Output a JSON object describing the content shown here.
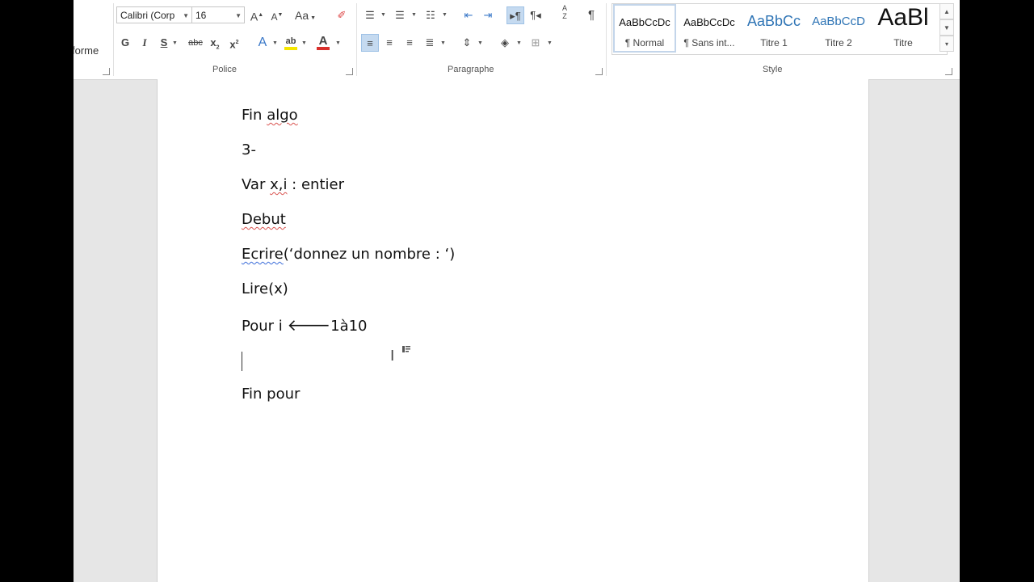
{
  "ribbon": {
    "clipped_label": "forme",
    "font": {
      "name": "Calibri (Corp",
      "size": "16"
    },
    "buttons": {
      "grow": "A",
      "shrink": "A",
      "case": "Aa",
      "bold": "G",
      "italic": "I",
      "underline": "S",
      "strike": "abc",
      "subscript": "x",
      "superscript": "x",
      "sub_mark": "2",
      "sup_mark": "2",
      "effects": "A",
      "highlight": "ab",
      "font_color": "A",
      "pilcrow": "¶",
      "sort_top": "A",
      "sort_bottom": "Z"
    },
    "groups": {
      "police": "Police",
      "paragraphe": "Paragraphe",
      "style": "Style"
    },
    "styles": [
      {
        "preview": "AaBbCcDc",
        "name": "¶ Normal"
      },
      {
        "preview": "AaBbCcDc",
        "name": "¶ Sans int..."
      },
      {
        "preview": "AaBbCc",
        "name": "Titre 1"
      },
      {
        "preview": "AaBbCcD",
        "name": "Titre 2"
      },
      {
        "preview": "AaBl",
        "name": "Titre"
      }
    ],
    "colors": {
      "highlight": "#f5e600",
      "font_color": "#d9302c",
      "title_blue": "#2e74b5"
    }
  },
  "document": {
    "l1a": "Fin ",
    "l1b": "algo",
    "l2": "3-",
    "l3a": "Var ",
    "l3b": "x,i",
    "l3c": " : entier",
    "l4": "Debut",
    "l5a": "Ecrire",
    "l5b": "(‘donnez un nombre : ‘)",
    "l6": "Lire(x)",
    "l7a": "Pour i ",
    "l7arrow": "🡐",
    "l7b": "1à10",
    "l8": "Fin pour"
  },
  "icons": {
    "ibeam": "Ⅰ"
  }
}
